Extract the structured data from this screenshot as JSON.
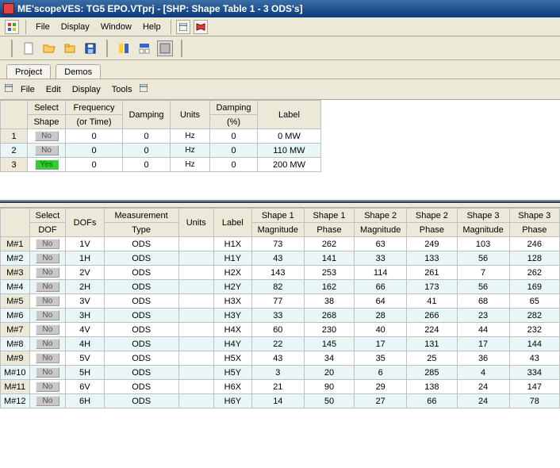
{
  "window": {
    "title": "ME'scopeVES: TG5 EPO.VTprj - [SHP: Shape Table 1 - 3 ODS's]"
  },
  "menu1": {
    "file": "File",
    "display": "Display",
    "window": "Window",
    "help": "Help"
  },
  "tabs": {
    "project": "Project",
    "demos": "Demos"
  },
  "menu2": {
    "file": "File",
    "edit": "Edit",
    "display": "Display",
    "tools": "Tools"
  },
  "table1": {
    "hdr": {
      "select1": "Select",
      "select2": "Shape",
      "freq1": "Frequency",
      "freq2": "(or Time)",
      "damp": "Damping",
      "units": "Units",
      "dpct1": "Damping",
      "dpct2": "(%)",
      "label": "Label"
    },
    "rows": [
      {
        "idx": "1",
        "sel": "No",
        "selYes": false,
        "freq": "0",
        "damp": "0",
        "units": "Hz",
        "dpct": "0",
        "label": "0 MW"
      },
      {
        "idx": "2",
        "sel": "No",
        "selYes": false,
        "freq": "0",
        "damp": "0",
        "units": "Hz",
        "dpct": "0",
        "label": "110 MW"
      },
      {
        "idx": "3",
        "sel": "Yes",
        "selYes": true,
        "freq": "0",
        "damp": "0",
        "units": "Hz",
        "dpct": "0",
        "label": "200 MW"
      }
    ]
  },
  "table2": {
    "hdr": {
      "sel1": "Select",
      "sel2": "DOF",
      "dofs": "DOFs",
      "mtype1": "Measurement",
      "mtype2": "Type",
      "units": "Units",
      "label": "Label",
      "s1m1": "Shape 1",
      "s1m2": "Magnitude",
      "s1p1": "Shape 1",
      "s1p2": "Phase",
      "s2m1": "Shape 2",
      "s2m2": "Magnitude",
      "s2p1": "Shape 2",
      "s2p2": "Phase",
      "s3m1": "Shape 3",
      "s3m2": "Magnitude",
      "s3p1": "Shape 3",
      "s3p2": "Phase"
    },
    "rows": [
      {
        "m": "M#1",
        "sel": "No",
        "dofs": "1V",
        "mtype": "ODS",
        "units": "",
        "label": "H1X",
        "s1m": "73",
        "s1p": "262",
        "s2m": "63",
        "s2p": "249",
        "s3m": "103",
        "s3p": "246"
      },
      {
        "m": "M#2",
        "sel": "No",
        "dofs": "1H",
        "mtype": "ODS",
        "units": "",
        "label": "H1Y",
        "s1m": "43",
        "s1p": "141",
        "s2m": "33",
        "s2p": "133",
        "s3m": "56",
        "s3p": "128"
      },
      {
        "m": "M#3",
        "sel": "No",
        "dofs": "2V",
        "mtype": "ODS",
        "units": "",
        "label": "H2X",
        "s1m": "143",
        "s1p": "253",
        "s2m": "114",
        "s2p": "261",
        "s3m": "7",
        "s3p": "262"
      },
      {
        "m": "M#4",
        "sel": "No",
        "dofs": "2H",
        "mtype": "ODS",
        "units": "",
        "label": "H2Y",
        "s1m": "82",
        "s1p": "162",
        "s2m": "66",
        "s2p": "173",
        "s3m": "56",
        "s3p": "169"
      },
      {
        "m": "M#5",
        "sel": "No",
        "dofs": "3V",
        "mtype": "ODS",
        "units": "",
        "label": "H3X",
        "s1m": "77",
        "s1p": "38",
        "s2m": "64",
        "s2p": "41",
        "s3m": "68",
        "s3p": "65"
      },
      {
        "m": "M#6",
        "sel": "No",
        "dofs": "3H",
        "mtype": "ODS",
        "units": "",
        "label": "H3Y",
        "s1m": "33",
        "s1p": "268",
        "s2m": "28",
        "s2p": "266",
        "s3m": "23",
        "s3p": "282"
      },
      {
        "m": "M#7",
        "sel": "No",
        "dofs": "4V",
        "mtype": "ODS",
        "units": "",
        "label": "H4X",
        "s1m": "60",
        "s1p": "230",
        "s2m": "40",
        "s2p": "224",
        "s3m": "44",
        "s3p": "232"
      },
      {
        "m": "M#8",
        "sel": "No",
        "dofs": "4H",
        "mtype": "ODS",
        "units": "",
        "label": "H4Y",
        "s1m": "22",
        "s1p": "145",
        "s2m": "17",
        "s2p": "131",
        "s3m": "17",
        "s3p": "144"
      },
      {
        "m": "M#9",
        "sel": "No",
        "dofs": "5V",
        "mtype": "ODS",
        "units": "",
        "label": "H5X",
        "s1m": "43",
        "s1p": "34",
        "s2m": "35",
        "s2p": "25",
        "s3m": "36",
        "s3p": "43"
      },
      {
        "m": "M#10",
        "sel": "No",
        "dofs": "5H",
        "mtype": "ODS",
        "units": "",
        "label": "H5Y",
        "s1m": "3",
        "s1p": "20",
        "s2m": "6",
        "s2p": "285",
        "s3m": "4",
        "s3p": "334"
      },
      {
        "m": "M#11",
        "sel": "No",
        "dofs": "6V",
        "mtype": "ODS",
        "units": "",
        "label": "H6X",
        "s1m": "21",
        "s1p": "90",
        "s2m": "29",
        "s2p": "138",
        "s3m": "24",
        "s3p": "147"
      },
      {
        "m": "M#12",
        "sel": "No",
        "dofs": "6H",
        "mtype": "ODS",
        "units": "",
        "label": "H6Y",
        "s1m": "14",
        "s1p": "50",
        "s2m": "27",
        "s2p": "66",
        "s3m": "24",
        "s3p": "78"
      }
    ]
  }
}
